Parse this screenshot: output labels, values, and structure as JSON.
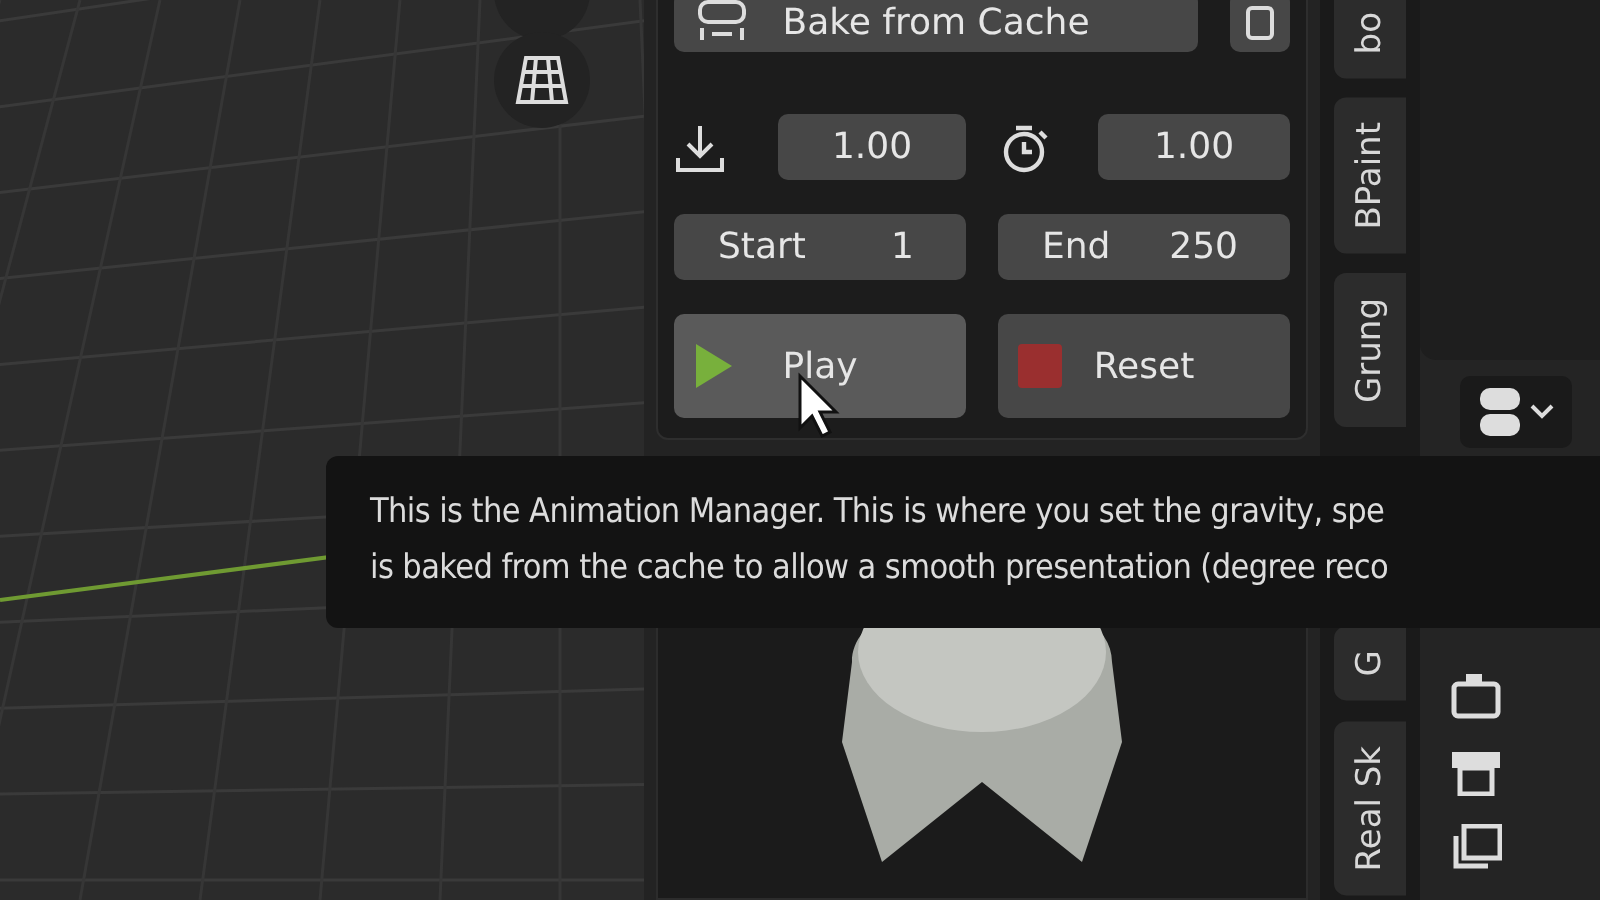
{
  "panel": {
    "bake_button": "Bake from Cache",
    "gravity_value": "1.00",
    "speed_value": "1.00",
    "start": {
      "label": "Start",
      "value": "1"
    },
    "end": {
      "label": "End",
      "value": "250"
    },
    "play_button": {
      "label": "Play",
      "hovered": true
    },
    "reset_button": {
      "label": "Reset",
      "hovered": false
    }
  },
  "tabs": [
    {
      "label": "bo"
    },
    {
      "label": "BPaint"
    },
    {
      "label": "Grung"
    },
    {
      "label": "G"
    },
    {
      "label": "Real Sk"
    }
  ],
  "tooltip": {
    "lines": [
      "This is the Animation Manager. This is where you set the gravity, spe",
      "is baked from the cache to allow a smooth presentation (degree reco"
    ]
  }
}
